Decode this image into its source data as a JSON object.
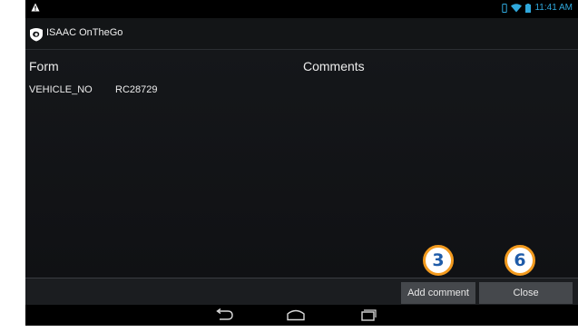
{
  "status_bar": {
    "time": "11:41 AM",
    "icons": [
      "warning-icon",
      "vibrate-icon",
      "wifi-icon",
      "battery-icon"
    ]
  },
  "app": {
    "title": "ISAAC OnTheGo",
    "logo_icon": "isaac-logo-icon"
  },
  "table": {
    "headers": {
      "form": "Form",
      "comments": "Comments"
    },
    "rows": [
      {
        "key": "VEHICLE_NO",
        "value": "RC28729"
      }
    ]
  },
  "buttons": {
    "add_comment": "Add comment",
    "close": "Close"
  },
  "annotations": {
    "add_comment_badge": "3",
    "close_badge": "6"
  },
  "nav": {
    "icons": [
      "back-icon",
      "home-icon",
      "recent-apps-icon"
    ]
  },
  "colors": {
    "accent": "#2fa8dc",
    "badge_border": "#f29a1e",
    "badge_text": "#1e5ba8",
    "button_bg": "#45484c"
  }
}
